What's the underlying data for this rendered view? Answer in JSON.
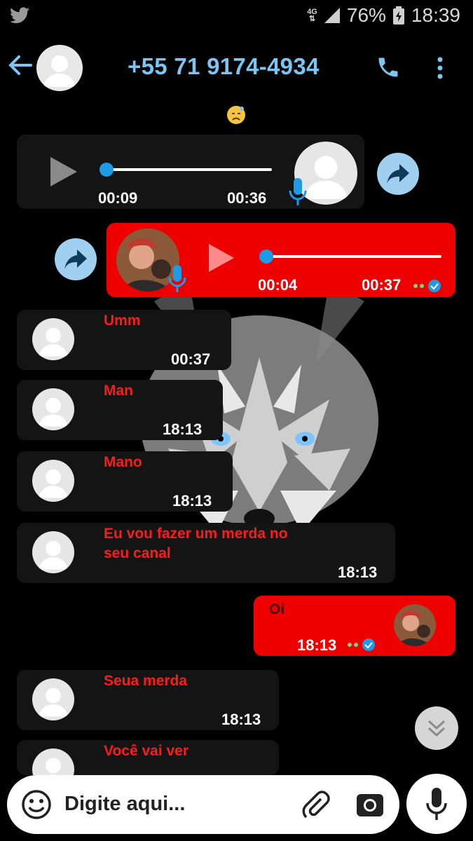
{
  "status_bar": {
    "network": "4G",
    "battery": "76%",
    "time": "18:39"
  },
  "header": {
    "title": "+55 71 9174-4934"
  },
  "messages": [
    {
      "type": "audio-in",
      "elapsed": "00:09",
      "duration": "00:36",
      "progress": 0
    },
    {
      "type": "audio-out",
      "elapsed": "00:04",
      "duration": "00:37",
      "progress": 0
    },
    {
      "type": "text-in",
      "text": "Umm",
      "time": "00:37"
    },
    {
      "type": "text-in",
      "text": "Man",
      "time": "18:13"
    },
    {
      "type": "text-in",
      "text": "Mano",
      "time": "18:13"
    },
    {
      "type": "text-in",
      "text": "Eu vou fazer um merda no seu canal",
      "time": "18:13"
    },
    {
      "type": "text-out",
      "text": "Oi",
      "time": "18:13"
    },
    {
      "type": "text-in",
      "text": "Seua merda",
      "time": "18:13"
    },
    {
      "type": "text-in",
      "text": "Você vai ver",
      "time": ""
    }
  ],
  "input": {
    "placeholder": "Digite aqui..."
  },
  "colors": {
    "accent": "#7cc4f2",
    "outgoing": "#ee0000",
    "incoming_text": "#ff1a1a",
    "share": "#9fd0ef"
  }
}
